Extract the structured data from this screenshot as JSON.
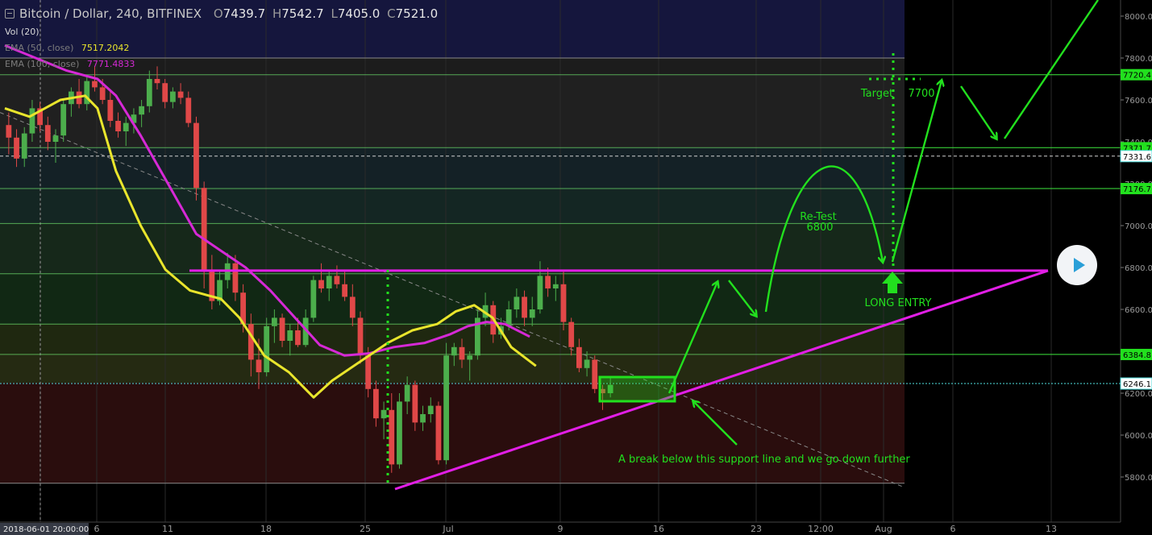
{
  "header": {
    "symbol": "Bitcoin / Dollar, 240, BITFINEX",
    "open_key": "O",
    "open": "7439.7",
    "high_key": "H",
    "high": "7542.7",
    "low_key": "L",
    "low": "7405.0",
    "close_key": "C",
    "close": "7521.0"
  },
  "indicators": {
    "vol_label": "Vol (20)",
    "ema50_label": "EMA (50, close)",
    "ema50_value": "7517.2042",
    "ema100_label": "EMA (100, close)",
    "ema100_value": "7771.4833"
  },
  "colors": {
    "ema50": "#e9e52c",
    "ema100": "#d629d6",
    "annotation_green": "#22e01e",
    "trendline": "#e21ee6",
    "up_candle": "#4cae4c",
    "down_candle": "#e04848",
    "price_axis_text": "#9b9b9b"
  },
  "chart_data": {
    "type": "candlestick",
    "y_range": [
      5700,
      8100
    ],
    "price_ticks": [
      8000,
      7800,
      7600,
      7400,
      7200,
      7000,
      6800,
      6600,
      6400,
      6200,
      6000,
      5800
    ],
    "price_tick_labels": [
      "8000.0",
      "7800.0",
      "7600.0",
      "7400.0",
      "7200.0",
      "7000.0",
      "6800.0",
      "6600.0",
      "6400.0",
      "6200.0",
      "6000.0",
      "5800.0"
    ],
    "x_labels": [
      "2018-06-01 20:00:00",
      "6",
      "11",
      "18",
      "25",
      "Jul",
      "9",
      "16",
      "23",
      "12:00",
      "Aug",
      "6",
      "13"
    ],
    "price_badges": [
      {
        "value": 7720.4,
        "label": "7720.4",
        "style": "green"
      },
      {
        "value": 7371.7,
        "label": "7371.7",
        "style": "green"
      },
      {
        "value": 7331.6,
        "label": "7331.6",
        "style": "white"
      },
      {
        "value": 7176.7,
        "label": "7176.7",
        "style": "green"
      },
      {
        "value": 6384.8,
        "label": "6384.8",
        "style": "green"
      },
      {
        "value": 6246.1,
        "label": "6246.1",
        "style": "white"
      }
    ],
    "horizontal_levels": [
      7720,
      7372,
      7177,
      7010,
      6770,
      6530,
      6385
    ],
    "support_resistance": 6785,
    "trendline": {
      "from": [
        "Jun 26",
        5750
      ],
      "to": [
        "Aug 13",
        6785
      ]
    },
    "annotations": [
      {
        "text": "Re-Test",
        "sub": "6800"
      },
      {
        "text": "Target",
        "value": "7700"
      },
      {
        "text": "LONG ENTRY"
      },
      {
        "text": "A break below this support line and we go down further"
      }
    ],
    "candles": [
      [
        7480,
        7540,
        7340,
        7420
      ],
      [
        7420,
        7460,
        7280,
        7320
      ],
      [
        7320,
        7470,
        7280,
        7440
      ],
      [
        7440,
        7600,
        7400,
        7560
      ],
      [
        7560,
        7590,
        7450,
        7480
      ],
      [
        7480,
        7520,
        7360,
        7400
      ],
      [
        7400,
        7460,
        7300,
        7430
      ],
      [
        7430,
        7600,
        7400,
        7580
      ],
      [
        7580,
        7660,
        7520,
        7640
      ],
      [
        7640,
        7700,
        7560,
        7580
      ],
      [
        7580,
        7720,
        7550,
        7690
      ],
      [
        7690,
        7760,
        7640,
        7660
      ],
      [
        7660,
        7700,
        7580,
        7600
      ],
      [
        7600,
        7640,
        7470,
        7500
      ],
      [
        7500,
        7540,
        7420,
        7450
      ],
      [
        7450,
        7520,
        7380,
        7490
      ],
      [
        7490,
        7560,
        7440,
        7530
      ],
      [
        7530,
        7600,
        7470,
        7570
      ],
      [
        7570,
        7740,
        7540,
        7700
      ],
      [
        7700,
        7760,
        7650,
        7680
      ],
      [
        7680,
        7700,
        7560,
        7590
      ],
      [
        7590,
        7660,
        7560,
        7640
      ],
      [
        7640,
        7680,
        7580,
        7610
      ],
      [
        7610,
        7640,
        7470,
        7490
      ],
      [
        7490,
        7520,
        7120,
        7180
      ],
      [
        7180,
        7210,
        6700,
        6780
      ],
      [
        6780,
        6860,
        6600,
        6640
      ],
      [
        6640,
        6780,
        6620,
        6740
      ],
      [
        6740,
        6870,
        6700,
        6820
      ],
      [
        6820,
        6860,
        6640,
        6680
      ],
      [
        6680,
        6720,
        6490,
        6530
      ],
      [
        6530,
        6580,
        6280,
        6360
      ],
      [
        6360,
        6460,
        6220,
        6300
      ],
      [
        6300,
        6560,
        6280,
        6520
      ],
      [
        6520,
        6600,
        6440,
        6560
      ],
      [
        6560,
        6580,
        6420,
        6450
      ],
      [
        6450,
        6530,
        6380,
        6500
      ],
      [
        6500,
        6560,
        6420,
        6430
      ],
      [
        6430,
        6600,
        6420,
        6560
      ],
      [
        6560,
        6760,
        6540,
        6740
      ],
      [
        6740,
        6820,
        6680,
        6700
      ],
      [
        6700,
        6790,
        6640,
        6760
      ],
      [
        6760,
        6810,
        6700,
        6720
      ],
      [
        6720,
        6780,
        6640,
        6660
      ],
      [
        6660,
        6720,
        6520,
        6560
      ],
      [
        6560,
        6590,
        6340,
        6380
      ],
      [
        6380,
        6420,
        6180,
        6220
      ],
      [
        6220,
        6260,
        6040,
        6080
      ],
      [
        6080,
        6160,
        5980,
        6120
      ],
      [
        6120,
        6200,
        5820,
        5860
      ],
      [
        5860,
        6200,
        5840,
        6160
      ],
      [
        6160,
        6280,
        6100,
        6240
      ],
      [
        6240,
        6260,
        6020,
        6060
      ],
      [
        6060,
        6140,
        6020,
        6100
      ],
      [
        6100,
        6180,
        6060,
        6140
      ],
      [
        6140,
        6160,
        5860,
        5880
      ],
      [
        5880,
        6440,
        5860,
        6380
      ],
      [
        6380,
        6440,
        6330,
        6420
      ],
      [
        6420,
        6460,
        6320,
        6360
      ],
      [
        6360,
        6400,
        6260,
        6380
      ],
      [
        6380,
        6600,
        6360,
        6560
      ],
      [
        6560,
        6680,
        6520,
        6620
      ],
      [
        6620,
        6640,
        6440,
        6480
      ],
      [
        6480,
        6560,
        6460,
        6520
      ],
      [
        6520,
        6640,
        6500,
        6600
      ],
      [
        6600,
        6700,
        6560,
        6660
      ],
      [
        6660,
        6690,
        6520,
        6560
      ],
      [
        6560,
        6660,
        6520,
        6600
      ],
      [
        6600,
        6830,
        6580,
        6760
      ],
      [
        6760,
        6800,
        6660,
        6700
      ],
      [
        6700,
        6760,
        6640,
        6720
      ],
      [
        6720,
        6780,
        6500,
        6540
      ],
      [
        6540,
        6560,
        6380,
        6420
      ],
      [
        6420,
        6460,
        6300,
        6320
      ],
      [
        6320,
        6400,
        6280,
        6360
      ],
      [
        6360,
        6380,
        6200,
        6220
      ],
      [
        6220,
        6240,
        6120,
        6200
      ],
      [
        6200,
        6280,
        6180,
        6240
      ]
    ],
    "ema50": [
      [
        0,
        7560
      ],
      [
        0.04,
        7520
      ],
      [
        0.09,
        7600
      ],
      [
        0.13,
        7620
      ],
      [
        0.15,
        7560
      ],
      [
        0.18,
        7260
      ],
      [
        0.22,
        7000
      ],
      [
        0.26,
        6790
      ],
      [
        0.3,
        6690
      ],
      [
        0.35,
        6650
      ],
      [
        0.38,
        6560
      ],
      [
        0.42,
        6380
      ],
      [
        0.46,
        6300
      ],
      [
        0.5,
        6180
      ],
      [
        0.53,
        6260
      ],
      [
        0.58,
        6360
      ],
      [
        0.62,
        6440
      ],
      [
        0.66,
        6500
      ],
      [
        0.7,
        6530
      ],
      [
        0.73,
        6590
      ],
      [
        0.76,
        6620
      ],
      [
        0.79,
        6560
      ],
      [
        0.82,
        6420
      ],
      [
        0.86,
        6330
      ]
    ],
    "ema100": [
      [
        0,
        7860
      ],
      [
        0.05,
        7800
      ],
      [
        0.1,
        7740
      ],
      [
        0.15,
        7700
      ],
      [
        0.18,
        7620
      ],
      [
        0.22,
        7430
      ],
      [
        0.27,
        7170
      ],
      [
        0.31,
        6960
      ],
      [
        0.35,
        6880
      ],
      [
        0.39,
        6800
      ],
      [
        0.43,
        6690
      ],
      [
        0.47,
        6560
      ],
      [
        0.51,
        6430
      ],
      [
        0.55,
        6380
      ],
      [
        0.59,
        6390
      ],
      [
        0.63,
        6420
      ],
      [
        0.68,
        6440
      ],
      [
        0.72,
        6480
      ],
      [
        0.75,
        6520
      ],
      [
        0.78,
        6540
      ],
      [
        0.81,
        6530
      ],
      [
        0.85,
        6470
      ]
    ]
  }
}
